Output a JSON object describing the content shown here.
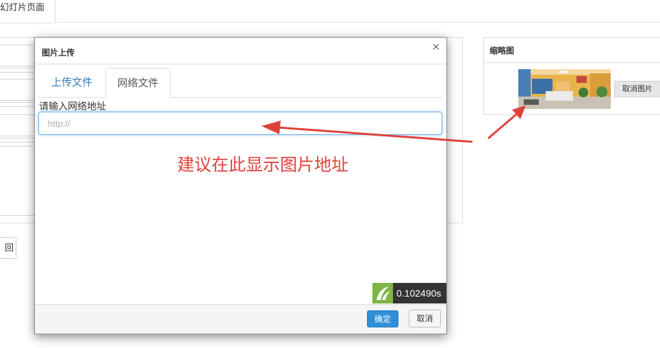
{
  "page": {
    "tab_label": "幻灯片页面",
    "back_button_label": "回"
  },
  "thumbnail": {
    "title": "缩略图",
    "cancel_label": "取消图片"
  },
  "modal": {
    "title": "图片上传",
    "close_glyph": "×",
    "tabs": [
      {
        "label": "上传文件",
        "active": false
      },
      {
        "label": "网络文件",
        "active": true
      }
    ],
    "url_label": "请输入网络地址",
    "url_placeholder": "http://",
    "url_value": "",
    "ok_label": "确定",
    "cancel_label": "取消"
  },
  "annotation": {
    "text": "建议在此显示图片地址",
    "color": "#e0413a"
  },
  "timer": {
    "text": "0.102490s",
    "logo_color": "#7fb545"
  },
  "colors": {
    "primary_button": "#2f8fd8",
    "focus_border": "#66afe9",
    "link_tab": "#337ab7"
  },
  "icons": {
    "close": "close-icon",
    "timer_logo": "leaf-logo-icon",
    "arrow": "red-arrow-annotation"
  }
}
